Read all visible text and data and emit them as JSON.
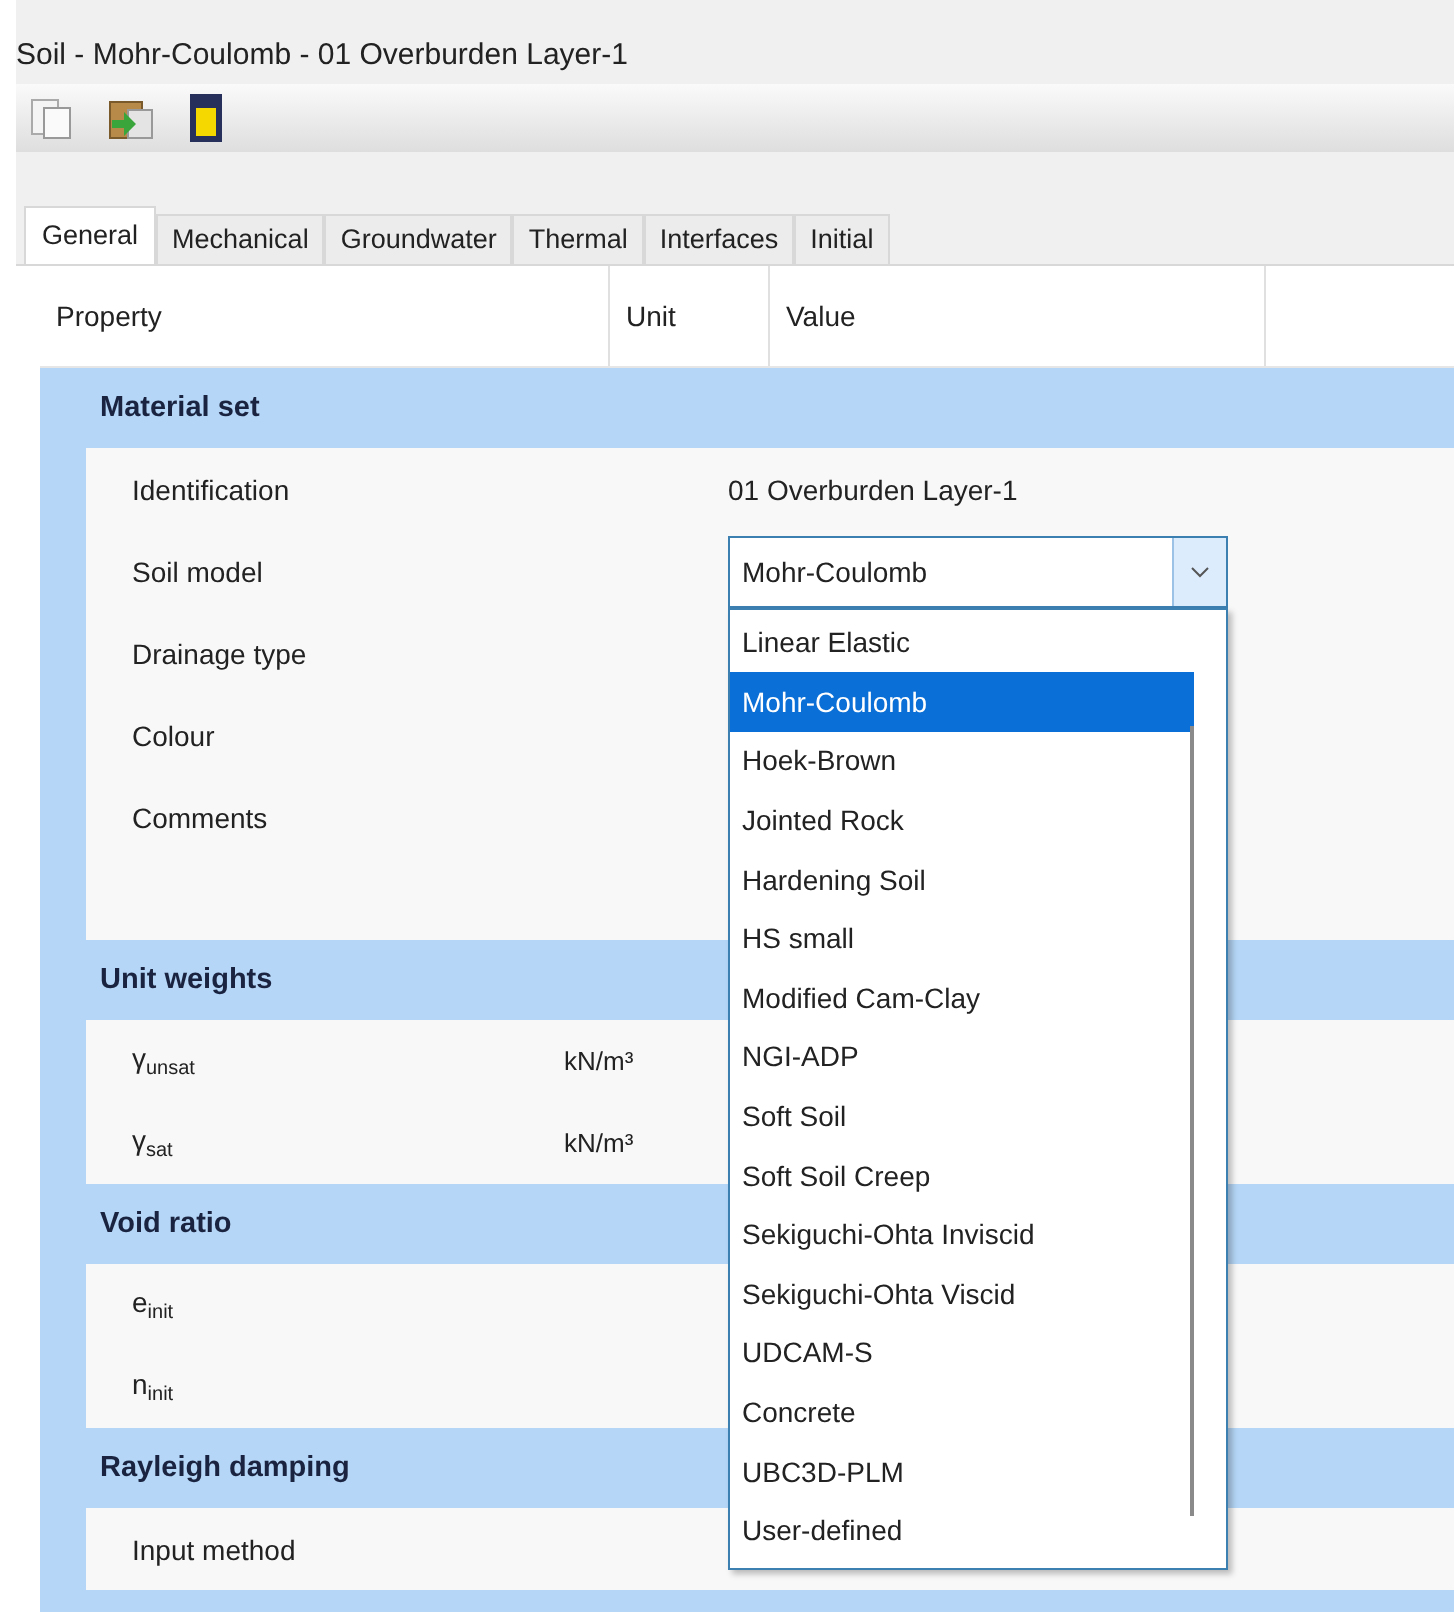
{
  "window": {
    "title": "Soil - Mohr-Coulomb - 01 Overburden Layer-1"
  },
  "tabs": [
    {
      "label": "General",
      "selected": true
    },
    {
      "label": "Mechanical",
      "selected": false
    },
    {
      "label": "Groundwater",
      "selected": false
    },
    {
      "label": "Thermal",
      "selected": false
    },
    {
      "label": "Interfaces",
      "selected": false
    },
    {
      "label": "Initial",
      "selected": false
    }
  ],
  "table": {
    "columns": [
      "Property",
      "Unit",
      "Value"
    ],
    "sections": [
      {
        "title": "Material set",
        "rows": [
          {
            "kind": "text",
            "property": "Identification",
            "value": "01 Overburden Layer-1"
          },
          {
            "kind": "combo",
            "property": "Soil model",
            "value": "Mohr-Coulomb",
            "expanded": true,
            "options": [
              {
                "label": "Linear Elastic",
                "selected": false
              },
              {
                "label": "Mohr-Coulomb",
                "selected": true
              },
              {
                "label": "Hoek-Brown",
                "selected": false
              },
              {
                "label": "Jointed Rock",
                "selected": false
              },
              {
                "label": "Hardening Soil",
                "selected": false
              },
              {
                "label": "HS small",
                "selected": false
              },
              {
                "label": "Modified Cam-Clay",
                "selected": false
              },
              {
                "label": "NGI-ADP",
                "selected": false
              },
              {
                "label": "Soft Soil",
                "selected": false
              },
              {
                "label": "Soft Soil Creep",
                "selected": false
              },
              {
                "label": "Sekiguchi-Ohta Inviscid",
                "selected": false
              },
              {
                "label": "Sekiguchi-Ohta Viscid",
                "selected": false
              },
              {
                "label": "UDCAM-S",
                "selected": false
              },
              {
                "label": "Concrete",
                "selected": false
              },
              {
                "label": "UBC3D-PLM",
                "selected": false
              },
              {
                "label": "User-defined",
                "selected": false
              }
            ]
          },
          {
            "kind": "text",
            "property": "Drainage type"
          },
          {
            "kind": "text",
            "property": "Colour"
          },
          {
            "kind": "memo",
            "property": "Comments"
          }
        ]
      },
      {
        "title": "Unit weights",
        "rows": [
          {
            "kind": "text",
            "property": "γ$_{unsat}$",
            "unit": "kN/m³"
          },
          {
            "kind": "text",
            "property": "γ$_{sat}$",
            "unit": "kN/m³"
          }
        ]
      },
      {
        "title": "Void ratio",
        "rows": [
          {
            "kind": "text",
            "property": "e$_{init}$"
          },
          {
            "kind": "text",
            "property": "n$_{init}$"
          }
        ]
      },
      {
        "title": "Rayleigh damping",
        "rows": [
          {
            "kind": "text",
            "property": "Input method"
          }
        ]
      }
    ]
  }
}
